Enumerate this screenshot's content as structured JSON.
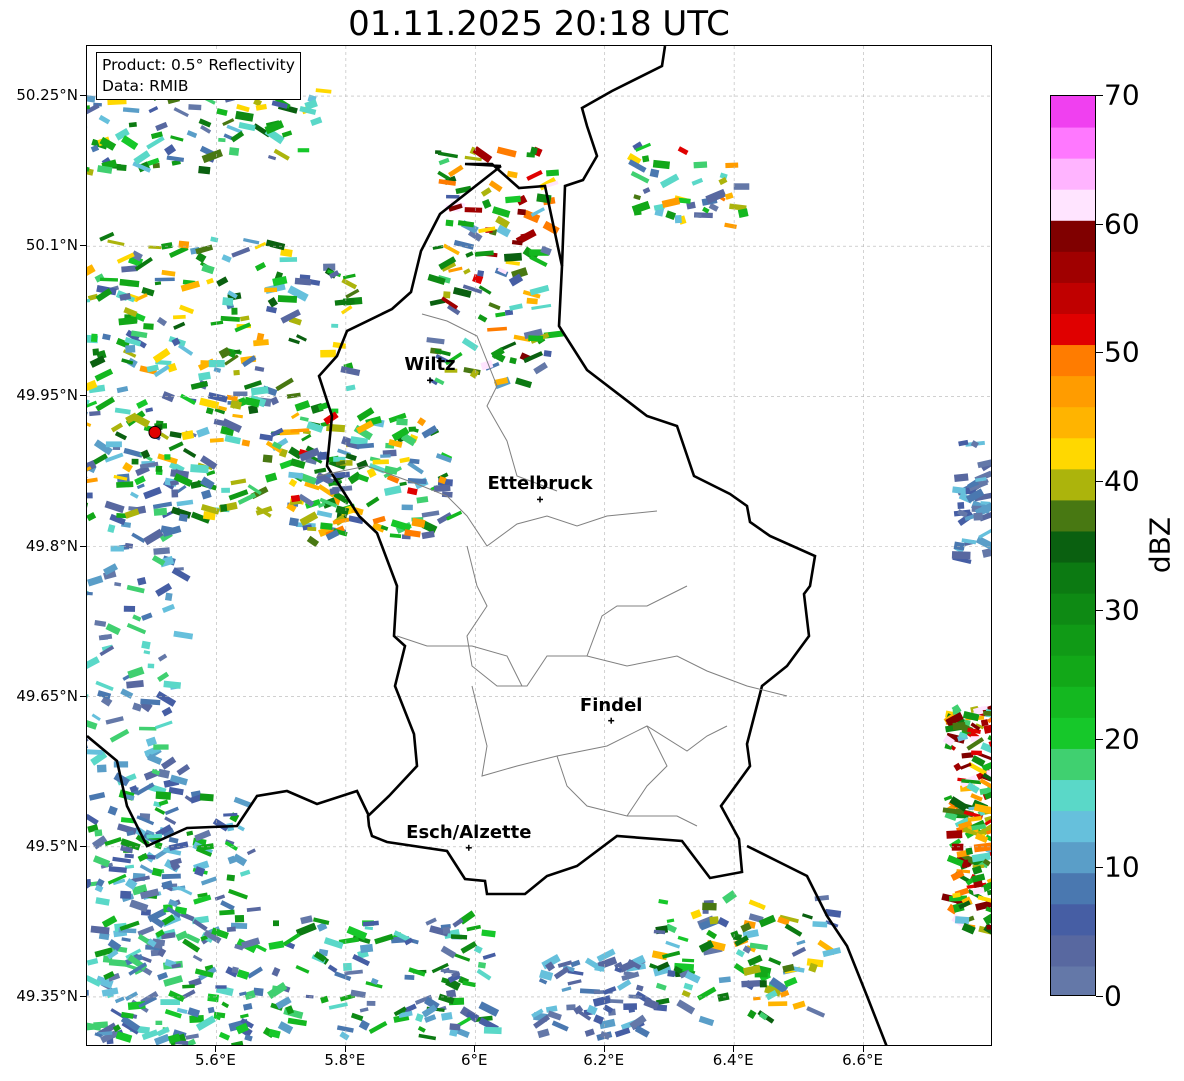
{
  "title": "01.11.2025 20:18 UTC",
  "info": {
    "product": "Product: 0.5° Reflectivity",
    "data": "Data: RMIB"
  },
  "axes": {
    "lat_ticks": [
      "50.25°N",
      "50.1°N",
      "49.95°N",
      "49.8°N",
      "49.65°N",
      "49.5°N",
      "49.35°N"
    ],
    "lon_ticks": [
      "5.6°E",
      "5.8°E",
      "6°E",
      "6.2°E",
      "6.4°E",
      "6.6°E"
    ],
    "lat_values": [
      50.25,
      50.1,
      49.95,
      49.8,
      49.65,
      49.5,
      49.35
    ],
    "lon_values": [
      5.6,
      5.8,
      6.0,
      6.2,
      6.4,
      6.6
    ],
    "lon_range": [
      5.4,
      6.8
    ],
    "lat_range": [
      49.3,
      50.3
    ]
  },
  "cities": [
    {
      "name": "Wiltz",
      "lon": 5.93,
      "lat": 49.966
    },
    {
      "name": "Ettelbruck",
      "lon": 6.1,
      "lat": 49.847
    },
    {
      "name": "Findel",
      "lon": 6.21,
      "lat": 49.626
    },
    {
      "name": "Esch/Alzette",
      "lon": 5.99,
      "lat": 49.499
    }
  ],
  "radar_site": {
    "lon": 5.505,
    "lat": 49.914,
    "color": "#e00000"
  },
  "colorbar": {
    "label": "dBZ",
    "ticks": [
      "0",
      "10",
      "20",
      "30",
      "40",
      "50",
      "60",
      "70"
    ],
    "min": 0,
    "max": 70,
    "colors": [
      "#6478a8",
      "#5868a0",
      "#465ea4",
      "#4a78b0",
      "#5a9ec8",
      "#66c0dc",
      "#5ad8c8",
      "#40d070",
      "#16c82a",
      "#14b820",
      "#12a818",
      "#109a16",
      "#0e8a14",
      "#0c7a12",
      "#0a6010",
      "#487812",
      "#acb40c",
      "#ffd800",
      "#ffb400",
      "#ff9c00",
      "#ff7c00",
      "#e00000",
      "#c00000",
      "#a00000",
      "#800000",
      "#ffe4ff",
      "#ffb4ff",
      "#ff78ff",
      "#f040f0"
    ]
  },
  "legend_colors": {
    "border": "#000000",
    "admin": "#808080",
    "grid": "#b4b4b4"
  }
}
